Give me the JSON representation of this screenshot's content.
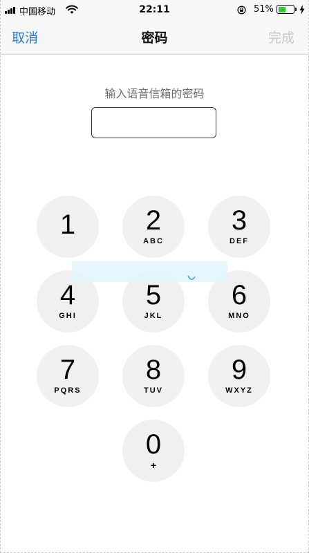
{
  "status_bar": {
    "carrier": "中国移动",
    "time": "22:11",
    "battery_percent": "51%",
    "battery_level": 0.51,
    "icons": [
      "signal-icon",
      "wifi-icon",
      "rotation-lock-icon",
      "battery-icon",
      "charging-bolt-icon"
    ],
    "battery_color": "#33c534"
  },
  "nav": {
    "cancel_label": "取消",
    "title": "密码",
    "done_label": "完成",
    "accent_color": "#2a7ad4",
    "disabled_color": "#c7c7cc"
  },
  "prompt": "输入语音信箱的密码",
  "passcode_value": "",
  "keypad": {
    "keys": [
      {
        "digit": "1",
        "letters": ""
      },
      {
        "digit": "2",
        "letters": "ABC"
      },
      {
        "digit": "3",
        "letters": "DEF"
      },
      {
        "digit": "4",
        "letters": "GHI"
      },
      {
        "digit": "5",
        "letters": "JKL"
      },
      {
        "digit": "6",
        "letters": "MNO"
      },
      {
        "digit": "7",
        "letters": "PQRS"
      },
      {
        "digit": "8",
        "letters": "TUV"
      },
      {
        "digit": "9",
        "letters": "WXYZ"
      },
      {
        "digit": "0",
        "letters": "+"
      }
    ]
  }
}
